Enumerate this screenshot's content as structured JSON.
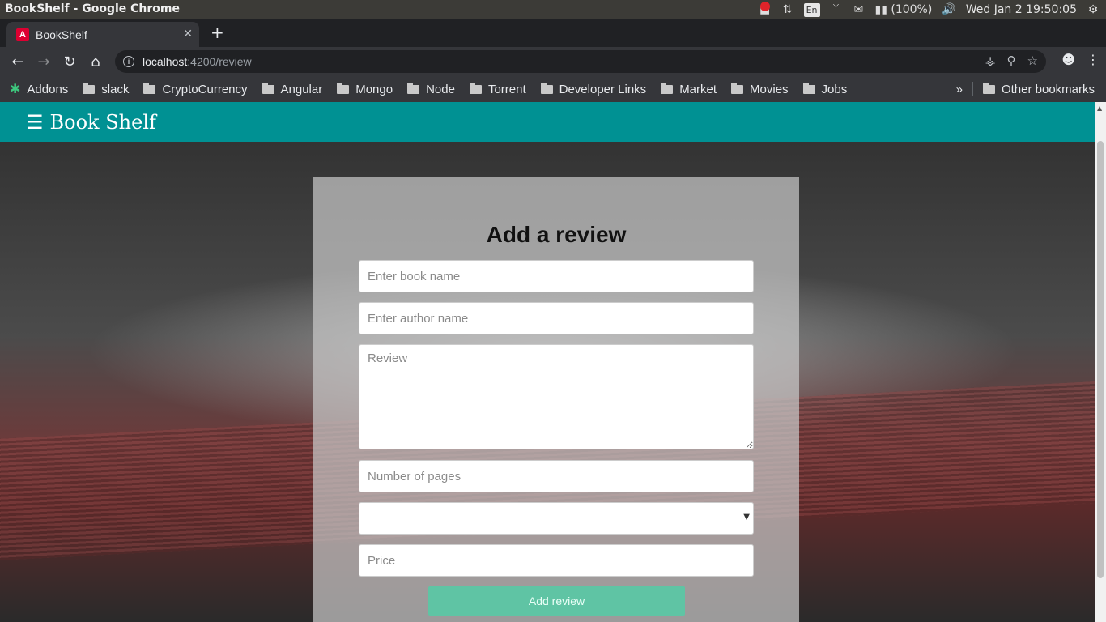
{
  "os": {
    "window_title": "BookShelf - Google Chrome",
    "lang": "En",
    "battery": "(100%)",
    "datetime": "Wed Jan  2 19:50:05"
  },
  "browser": {
    "tab_title": "BookShelf",
    "url_host": "localhost",
    "url_path": ":4200/review",
    "bookmarks": [
      "Addons",
      "slack",
      "CryptoCurrency",
      "Angular",
      "Mongo",
      "Node",
      "Torrent",
      "Developer Links",
      "Market",
      "Movies",
      "Jobs"
    ],
    "overflow": "»",
    "other_bookmarks": "Other bookmarks"
  },
  "app": {
    "brand": "Book Shelf",
    "menu_icon": "☰"
  },
  "form": {
    "title": "Add a review",
    "book_name_placeholder": "Enter book name",
    "author_placeholder": "Enter author name",
    "review_placeholder": "Review",
    "pages_placeholder": "Number of pages",
    "rating_value": "",
    "price_placeholder": "Price",
    "submit_label": "Add review"
  },
  "colors": {
    "navbar": "#009193",
    "submit": "#5fc4a4"
  }
}
